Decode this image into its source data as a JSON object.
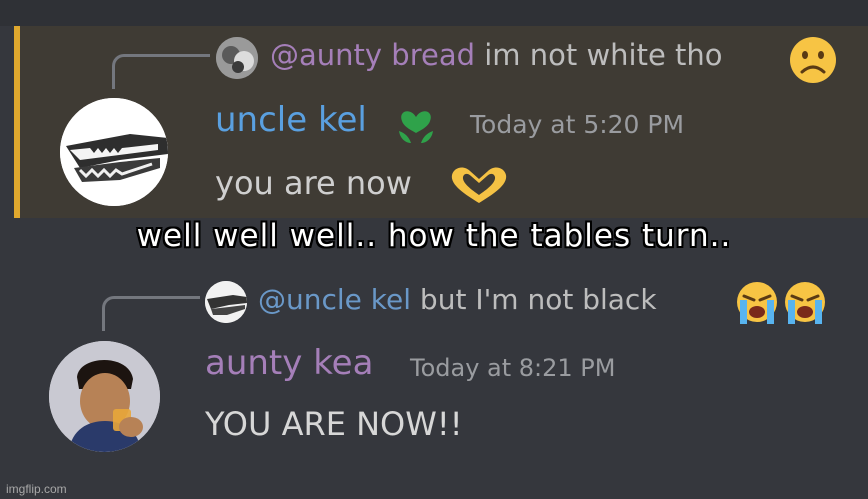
{
  "meme_caption": "well well well.. how the tables turn..",
  "message_1": {
    "reply": {
      "mention": "@aunty bread",
      "text": "im not white tho"
    },
    "author": "uncle kel",
    "timestamp": "Today at 5:20 PM",
    "content": "you are now"
  },
  "message_2": {
    "reply": {
      "mention": "@uncle kel",
      "text": "but I'm not black"
    },
    "author": "aunty kea",
    "timestamp": "Today at 8:21 PM",
    "content": "YOU ARE NOW!!"
  },
  "watermark": "imgflip.com",
  "colors": {
    "highlight_bar": "#e0a82e",
    "author1": "#5aa0e0",
    "author2": "#a57fb9",
    "mention1": "#a57fb9",
    "mention2": "#6a98c8"
  },
  "icons": [
    "frowning-face-emoji",
    "heart-hands-emoji",
    "loudly-crying-face-emoji",
    "green-role-icon"
  ]
}
